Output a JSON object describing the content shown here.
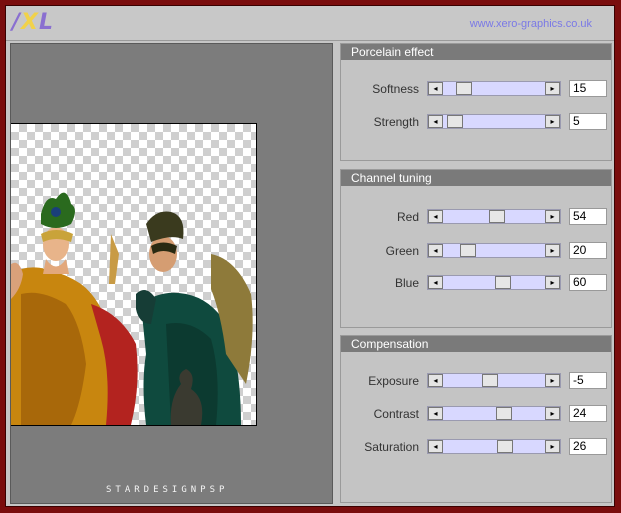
{
  "header": {
    "logo_part1": "/",
    "logo_part2": "X",
    "logo_part3": "L",
    "website": "www.xero-graphics.co.uk"
  },
  "preview": {
    "watermark": "STARDESIGNPSP"
  },
  "panels": [
    {
      "title": "Porcelain effect",
      "sliders": [
        {
          "label": "Softness",
          "value": "15",
          "fraction": 0.15
        },
        {
          "label": "Strength",
          "value": "5",
          "fraction": 0.05
        }
      ]
    },
    {
      "title": "Channel tuning",
      "sliders": [
        {
          "label": "Red",
          "value": "54",
          "fraction": 0.54
        },
        {
          "label": "Green",
          "value": "20",
          "fraction": 0.2
        },
        {
          "label": "Blue",
          "value": "60",
          "fraction": 0.6
        }
      ]
    },
    {
      "title": "Compensation",
      "sliders": [
        {
          "label": "Exposure",
          "value": "-5",
          "fraction": 0.45
        },
        {
          "label": "Contrast",
          "value": "24",
          "fraction": 0.62
        },
        {
          "label": "Saturation",
          "value": "26",
          "fraction": 0.63
        }
      ]
    }
  ],
  "colors": {
    "frame": "#7a0d0d",
    "panel_title_bg": "#7a7a7a",
    "slider_track": "#d8d8ff",
    "link": "#7a79e6"
  },
  "icons": {
    "left_arrow": "arrow-left-icon",
    "right_arrow": "arrow-right-icon"
  }
}
